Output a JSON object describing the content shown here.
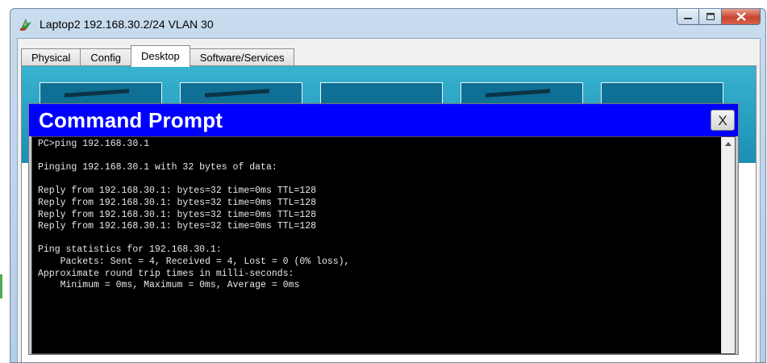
{
  "window": {
    "title": "Laptop2 192.168.30.2/24 VLAN 30",
    "icon": "packet-tracer-icon",
    "controls": [
      "minimize-icon",
      "maximize-icon",
      "close-icon"
    ]
  },
  "tabs": [
    {
      "label": "Physical",
      "active": false
    },
    {
      "label": "Config",
      "active": false
    },
    {
      "label": "Desktop",
      "active": true
    },
    {
      "label": "Software/Services",
      "active": false
    }
  ],
  "command_prompt": {
    "title": "Command Prompt",
    "close_label": "X",
    "lines": [
      "PC>ping 192.168.30.1",
      "",
      "Pinging 192.168.30.1 with 32 bytes of data:",
      "",
      "Reply from 192.168.30.1: bytes=32 time=0ms TTL=128",
      "Reply from 192.168.30.1: bytes=32 time=0ms TTL=128",
      "Reply from 192.168.30.1: bytes=32 time=0ms TTL=128",
      "Reply from 192.168.30.1: bytes=32 time=0ms TTL=128",
      "",
      "Ping statistics for 192.168.30.1:",
      "    Packets: Sent = 4, Received = 4, Lost = 0 (0% loss),",
      "Approximate round trip times in milli-seconds:",
      "    Minimum = 0ms, Maximum = 0ms, Average = 0ms"
    ]
  },
  "colors": {
    "cmd_header": "#0000ff",
    "console_bg": "#000000",
    "console_fg": "#e8e8e8",
    "desktop_strip": "#1b8fb4"
  }
}
